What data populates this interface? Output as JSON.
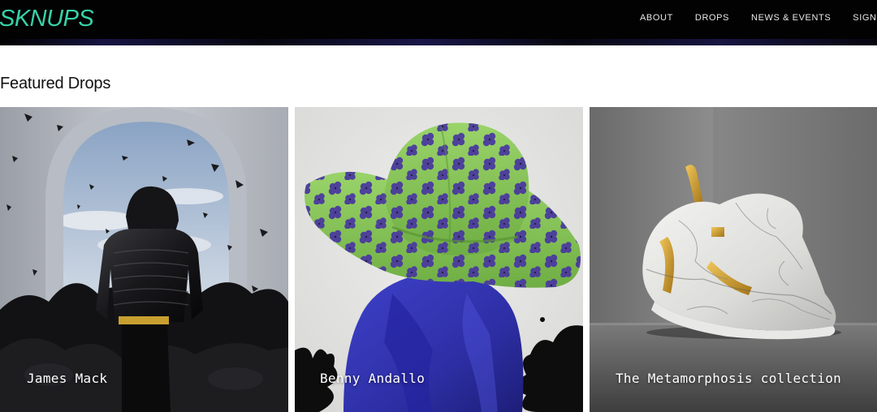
{
  "brand": {
    "logo_text": "SKNUPS",
    "accent_color": "#37d3a8"
  },
  "nav": {
    "items": [
      {
        "label": "ABOUT"
      },
      {
        "label": "DROPS"
      },
      {
        "label": "NEWS & EVENTS"
      },
      {
        "label": "SIGN UP"
      }
    ]
  },
  "featured": {
    "title": "Featured Drops",
    "cards": [
      {
        "label": "James Mack",
        "image": "puffer-jacket-figure-image"
      },
      {
        "label": "Benny Andallo",
        "image": "floral-bucket-hat-image"
      },
      {
        "label": "The Metamorphosis collection",
        "image": "marble-sneaker-image"
      }
    ]
  }
}
